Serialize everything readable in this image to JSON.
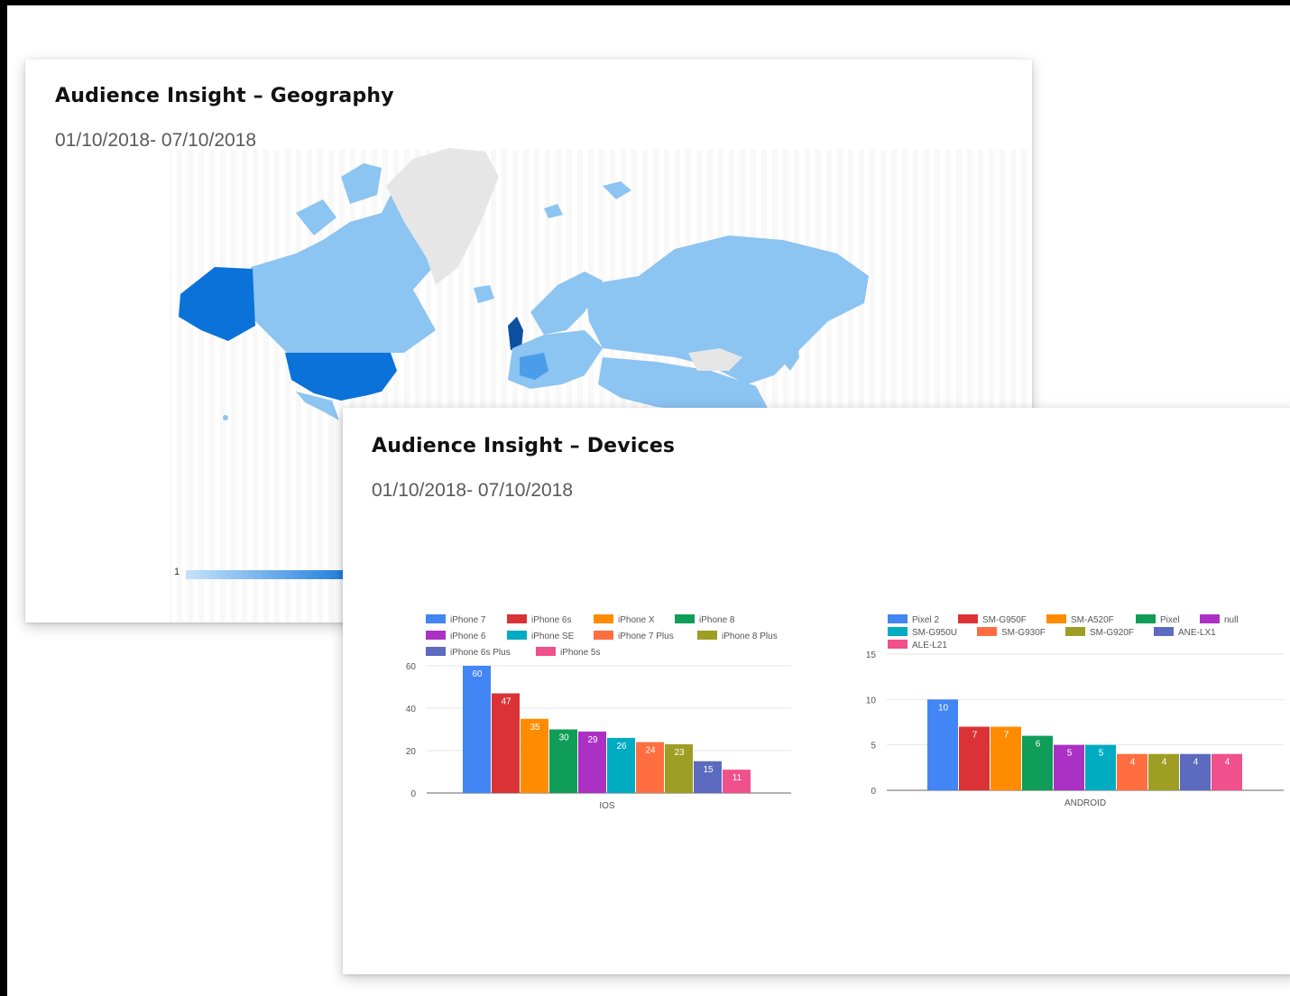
{
  "geo_card": {
    "title": "Audience Insight – Geography",
    "date_range": "01/10/2018- 07/10/2018",
    "scale_min_label": "1",
    "colors": {
      "low": "#c6e2fb",
      "mid": "#8cc4f2",
      "high": "#0a72d9",
      "no_data": "#e6e6e6"
    }
  },
  "devices_card": {
    "title": "Audience Insight – Devices",
    "date_range": "01/10/2018- 07/10/2018"
  },
  "chart_data": [
    {
      "type": "bar",
      "categories": [
        "IOS"
      ],
      "ylim": [
        0,
        60
      ],
      "yticks": [
        0,
        20,
        40,
        60
      ],
      "legend_position": "top",
      "grid": true,
      "series": [
        {
          "name": "iPhone 7",
          "values": [
            60
          ],
          "color": "#4285f4"
        },
        {
          "name": "iPhone 6s",
          "values": [
            47
          ],
          "color": "#db3236"
        },
        {
          "name": "iPhone X",
          "values": [
            35
          ],
          "color": "#ff8c00"
        },
        {
          "name": "iPhone 8",
          "values": [
            30
          ],
          "color": "#0f9d58"
        },
        {
          "name": "iPhone 6",
          "values": [
            29
          ],
          "color": "#ab30c4"
        },
        {
          "name": "iPhone SE",
          "values": [
            26
          ],
          "color": "#00acc1"
        },
        {
          "name": "iPhone 7 Plus",
          "values": [
            24
          ],
          "color": "#ff6e40"
        },
        {
          "name": "iPhone 8 Plus",
          "values": [
            23
          ],
          "color": "#9e9d24"
        },
        {
          "name": "iPhone 6s Plus",
          "values": [
            15
          ],
          "color": "#5c6bc0"
        },
        {
          "name": "iPhone 5s",
          "values": [
            11
          ],
          "color": "#f0508c"
        }
      ]
    },
    {
      "type": "bar",
      "categories": [
        "ANDROID"
      ],
      "ylim": [
        0,
        15
      ],
      "yticks": [
        0,
        5,
        10,
        15
      ],
      "legend_position": "top",
      "grid": true,
      "series": [
        {
          "name": "Pixel 2",
          "values": [
            10
          ],
          "color": "#4285f4"
        },
        {
          "name": "SM-G950F",
          "values": [
            7
          ],
          "color": "#db3236"
        },
        {
          "name": "SM-A520F",
          "values": [
            7
          ],
          "color": "#ff8c00"
        },
        {
          "name": "Pixel",
          "values": [
            6
          ],
          "color": "#0f9d58"
        },
        {
          "name": "null",
          "values": [
            5
          ],
          "color": "#ab30c4"
        },
        {
          "name": "SM-G950U",
          "values": [
            5
          ],
          "color": "#00acc1"
        },
        {
          "name": "SM-G930F",
          "values": [
            4
          ],
          "color": "#ff6e40"
        },
        {
          "name": "SM-G920F",
          "values": [
            4
          ],
          "color": "#9e9d24"
        },
        {
          "name": "ANE-LX1",
          "values": [
            4
          ],
          "color": "#5c6bc0"
        },
        {
          "name": "ALE-L21",
          "values": [
            4
          ],
          "color": "#f0508c"
        }
      ]
    }
  ]
}
